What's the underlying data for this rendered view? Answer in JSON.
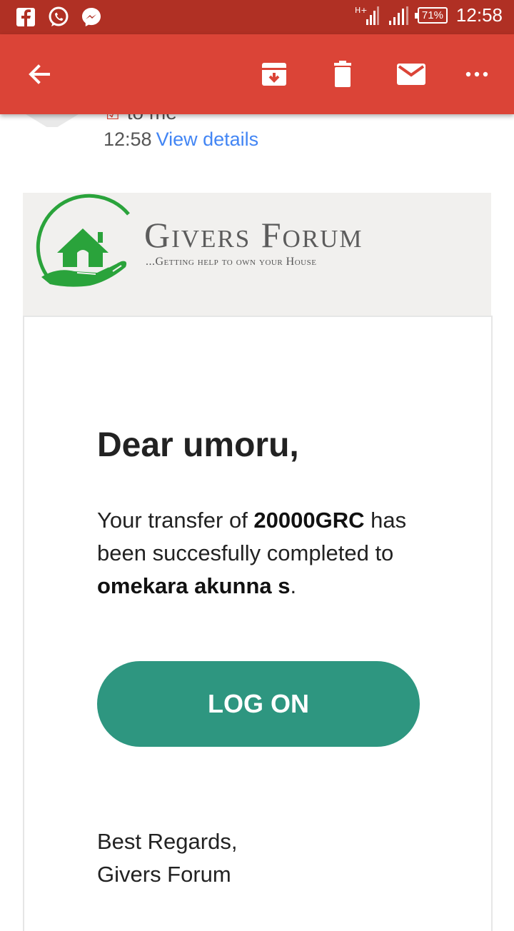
{
  "status_bar": {
    "network": "H+",
    "battery": "71%",
    "time": "12:58",
    "left_icons": [
      "facebook-icon",
      "whatsapp-icon",
      "messenger-icon"
    ]
  },
  "app_bar": {
    "color": "#db4437",
    "actions": [
      "back-arrow-icon",
      "archive-icon",
      "delete-icon",
      "mark-unread-icon",
      "more-options-icon"
    ]
  },
  "email_header": {
    "recipient": "to me",
    "time": "12:58",
    "view_details": "View details"
  },
  "banner": {
    "brand_name": "Givers Forum",
    "tagline": "...Getting help to own your House"
  },
  "body": {
    "greeting": "Dear umoru,",
    "text_intro": "Your transfer of ",
    "amount": "20000GRC",
    "text_middle": " has been succesfully completed to ",
    "recipient_name": "omekara akunna s",
    "text_end": ".",
    "button_label": "LOG ON",
    "signoff_line1": "Best Regards,",
    "signoff_line2": "Givers Forum"
  },
  "colors": {
    "status_bar": "#b03024",
    "accent_button": "#2e9680",
    "logo_green": "#2aa33b",
    "link": "#4285f4"
  }
}
